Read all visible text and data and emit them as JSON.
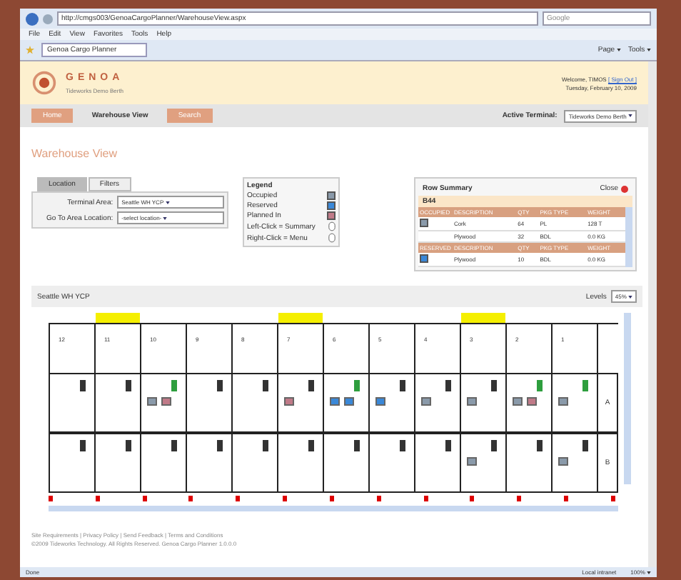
{
  "browser": {
    "address": "http://cmgs003/GenoaCargoPlanner/WarehouseView.aspx",
    "search_placeholder": "Google",
    "menu": [
      "File",
      "Edit",
      "View",
      "Favorites",
      "Tools",
      "Help"
    ],
    "tab": "Genoa Cargo Planner",
    "toolbar": [
      "Page",
      "Tools"
    ]
  },
  "header": {
    "logo": "GENOA",
    "tagline": "Tideworks Demo Berth",
    "welcome": "Welcome, TIMOS",
    "sign_out": "[ Sign Out ]",
    "date": "Tuesday, February 10, 2009"
  },
  "nav": [
    {
      "label": "Home",
      "selected": false
    },
    {
      "label": "Warehouse View",
      "selected": true
    },
    {
      "label": "Search",
      "selected": false
    }
  ],
  "active_terminal": {
    "label": "Active Terminal:",
    "value": "Tideworks Demo Berth"
  },
  "page_title": "Warehouse View",
  "location_panel": {
    "tabs": [
      {
        "label": "Location",
        "selected": true
      },
      {
        "label": "Filters",
        "selected": false
      }
    ],
    "fields": [
      {
        "label": "Terminal Area:",
        "value": "Seattle WH YCP"
      },
      {
        "label": "Go To Area Location:",
        "value": "-select location-"
      }
    ]
  },
  "legend": {
    "title": "Legend",
    "items": [
      {
        "label": "Occupied",
        "color": "#8a9aaa"
      },
      {
        "label": "Reserved",
        "color": "#3a88d8"
      },
      {
        "label": "Planned In",
        "color": "#c07a88"
      }
    ],
    "hints": [
      "Left-Click = Summary",
      "Right-Click = Menu"
    ]
  },
  "row_summary": {
    "title": "Row Summary",
    "close": "Close",
    "row": "B44",
    "sections": [
      {
        "heading": "OCCUPIED",
        "columns": [
          "DESCRIPTION",
          "QTY",
          "PKG TYPE",
          "WEIGHT"
        ],
        "rows": [
          {
            "color": "#8a9aaa",
            "cells": [
              "Cork",
              "64",
              "PL",
              "128 T"
            ]
          },
          {
            "cells": [
              "Plywood",
              "32",
              "BDL",
              "0.0 KG"
            ]
          }
        ]
      },
      {
        "heading": "RESERVED",
        "columns": [
          "DESCRIPTION",
          "QTY",
          "PKG TYPE",
          "WEIGHT"
        ],
        "rows": [
          {
            "color": "#3a88d8",
            "cells": [
              "Plywood",
              "10",
              "BDL",
              "0.0 KG"
            ]
          }
        ]
      }
    ]
  },
  "warehouse": {
    "area": "Seattle WH YCP",
    "levels_label": "Levels",
    "zoom": "45%",
    "bays": [
      {
        "number": "12",
        "door": false
      },
      {
        "number": "11",
        "door": true
      },
      {
        "number": "10",
        "door": false
      },
      {
        "number": "9",
        "door": false
      },
      {
        "number": "8",
        "door": false
      },
      {
        "number": "7",
        "door": true
      },
      {
        "number": "6",
        "door": false
      },
      {
        "number": "5",
        "door": false
      },
      {
        "number": "4",
        "door": false
      },
      {
        "number": "3",
        "door": true
      },
      {
        "number": "2",
        "door": false
      },
      {
        "number": "1",
        "door": false
      }
    ],
    "rows": [
      {
        "label": "A",
        "cells": [
          {
            "color": "#333333"
          },
          {
            "color": "#333333"
          },
          {
            "color": "#2e9e3e",
            "blocks": [
              {
                "color": "#8a9aaa"
              },
              {
                "color": "#c07a88"
              }
            ]
          },
          {
            "color": "#333333"
          },
          {
            "color": "#333333"
          },
          {
            "color": "#333333",
            "blocks": [
              {
                "color": "#c07a88"
              }
            ]
          },
          {
            "color": "#2e9e3e",
            "blocks": [
              {
                "color": "#3a88d8"
              },
              {
                "color": "#3a88d8"
              }
            ]
          },
          {
            "color": "#333333",
            "blocks": [
              {
                "color": "#3a88d8"
              }
            ]
          },
          {
            "color": "#333333",
            "blocks": [
              {
                "color": "#8a9aaa"
              }
            ]
          },
          {
            "color": "#333333",
            "blocks": [
              {
                "color": "#8a9aaa"
              }
            ]
          },
          {
            "color": "#2e9e3e",
            "blocks": [
              {
                "color": "#8a9aaa"
              },
              {
                "color": "#c07a88"
              }
            ]
          },
          {
            "color": "#2e9e3e",
            "blocks": [
              {
                "color": "#8a9aaa"
              }
            ]
          }
        ]
      },
      {
        "label": "B",
        "cells": [
          {
            "color": "#333333"
          },
          {
            "color": "#333333"
          },
          {
            "color": "#333333"
          },
          {
            "color": "#333333"
          },
          {
            "color": "#333333"
          },
          {
            "color": "#333333"
          },
          {
            "color": "#333333"
          },
          {
            "color": "#333333"
          },
          {
            "color": "#333333"
          },
          {
            "color": "#333333",
            "blocks": [
              {
                "color": "#8a9aaa"
              }
            ]
          },
          {
            "color": "#333333"
          },
          {
            "color": "#333333",
            "blocks": [
              {
                "color": "#8a9aaa"
              }
            ]
          }
        ]
      }
    ]
  },
  "footer": {
    "links": "Site Requirements | Privacy Policy | Send Feedback | Terms and Conditions",
    "copyright": "©2009 Tideworks Technology. All Rights Reserved. Genoa Cargo Planner 1.0.0.0"
  },
  "status_bar": {
    "status": "Done",
    "zone": "Local intranet",
    "zoom": "100%"
  }
}
